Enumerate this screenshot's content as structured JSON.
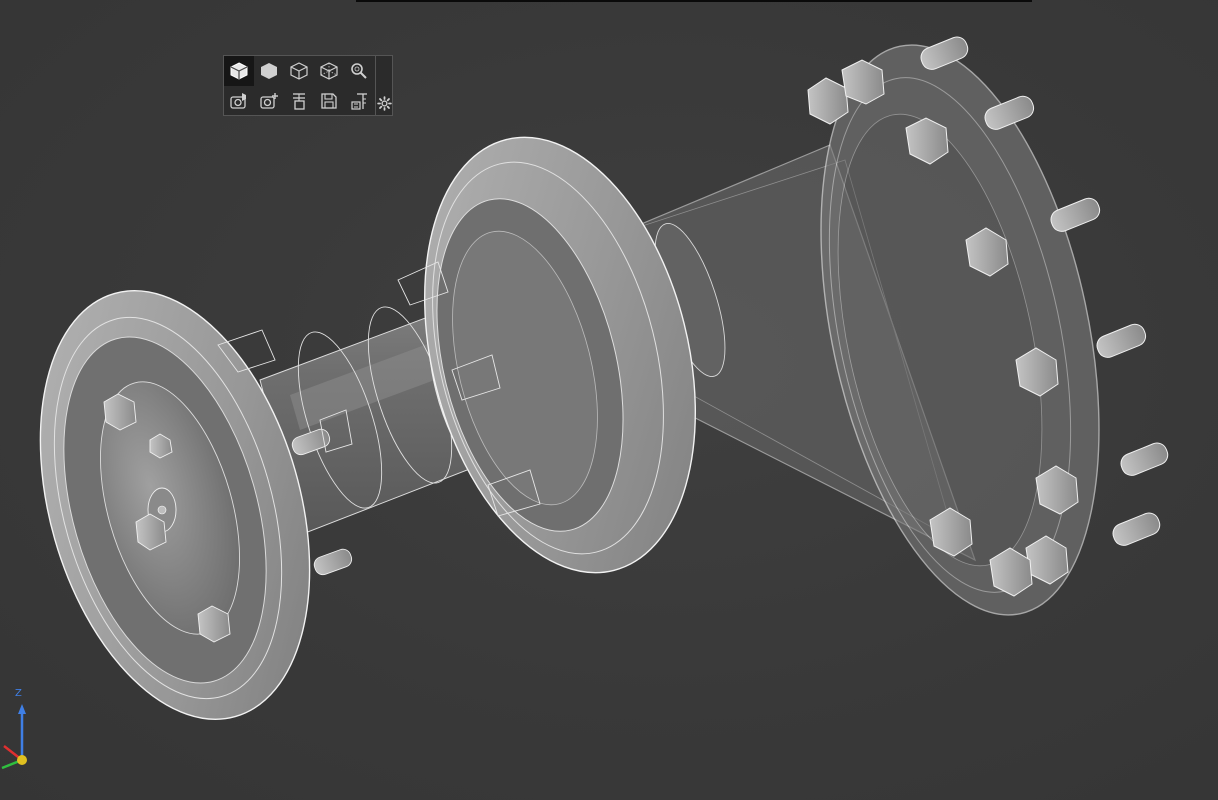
{
  "viewport": {
    "background": "#3a3a3a",
    "model_color": "#9a9a9a",
    "edge_color": "#e8e8e8"
  },
  "toolbar": {
    "row1": [
      {
        "name": "view-shaded-edges-button",
        "icon": "cube-shaded-edges-icon",
        "active": true
      },
      {
        "name": "view-shaded-button",
        "icon": "hexagon-solid-icon",
        "active": false
      },
      {
        "name": "view-wireframe-button",
        "icon": "cube-wireframe-icon",
        "active": false
      },
      {
        "name": "view-hidden-lines-button",
        "icon": "cube-hidden-lines-icon",
        "active": false
      },
      {
        "name": "zoom-button",
        "icon": "zoom-magnifier-icon",
        "active": false
      }
    ],
    "row2": [
      {
        "name": "snapshot-button",
        "icon": "camera-cube-icon"
      },
      {
        "name": "add-snapshot-button",
        "icon": "camera-add-icon"
      },
      {
        "name": "section-button",
        "icon": "section-plane-icon"
      },
      {
        "name": "save-view-button",
        "icon": "floppy-disk-icon"
      },
      {
        "name": "measure-button",
        "icon": "ruler-icon"
      }
    ],
    "settings_icon": "gear-icon"
  },
  "axis": {
    "z_label": "Z",
    "x_color": "#e03030",
    "y_color": "#2fbf3f",
    "z_color": "#3f7fe6",
    "origin_color": "#e0c020"
  }
}
